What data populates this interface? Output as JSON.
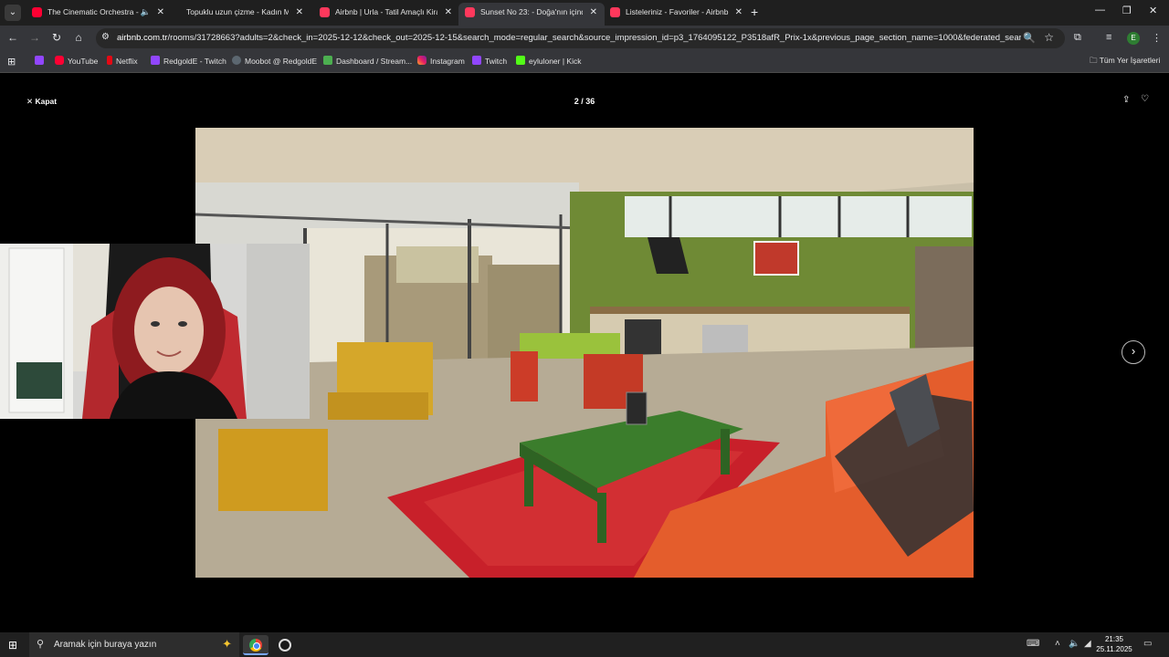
{
  "browser": {
    "tabs": [
      {
        "title": "The Cinematic Orchestra - T",
        "favicon": "youtube",
        "muted_icon": true,
        "active": false
      },
      {
        "title": "Topuklu uzun çizme - Kadın Mo",
        "favicon": "none",
        "active": false
      },
      {
        "title": "Airbnb | Urla - Tatil Amaçlı Kira",
        "favicon": "airbnb",
        "active": false
      },
      {
        "title": "Sunset No 23: - Doğa'nın içind",
        "favicon": "airbnb",
        "active": true
      },
      {
        "title": "Listeleriniz - Favoriler - Airbnb",
        "favicon": "airbnb",
        "active": false
      }
    ],
    "url_domain": "airbnb.com.tr",
    "url_rest": "/rooms/31728663?adults=2&check_in=2025-12-12&check_out=2025-12-15&search_mode=regular_search&source_impression_id=p3_1764095122_P3518afR_Prix-1x&previous_page_section_name=1000&federated_search_i...",
    "profile_initial": "E",
    "bookmarks": [
      {
        "label": "",
        "icon": "twitch"
      },
      {
        "label": "YouTube",
        "icon": "yt"
      },
      {
        "label": "Netflix",
        "icon": "nf"
      },
      {
        "label": "RedgoldE - Twitch",
        "icon": "twitch"
      },
      {
        "label": "Moobot @ RedgoldE",
        "icon": "moo"
      },
      {
        "label": "Dashboard / Stream...",
        "icon": "dash"
      },
      {
        "label": "Instagram",
        "icon": "ig"
      },
      {
        "label": "Twitch",
        "icon": "twitch"
      },
      {
        "label": "eyluloner | Kick",
        "icon": "kick"
      }
    ],
    "all_bookmarks_label": "Tüm Yer İşaretleri"
  },
  "viewer": {
    "close_label": "Kapat",
    "counter": "2 / 36",
    "next_icon": "chevron-right-icon"
  },
  "taskbar": {
    "search_placeholder": "Aramak için buraya yazın",
    "time": "21:35",
    "date": "25.11.2025"
  },
  "colors": {
    "airbnb_accent": "#ff385c",
    "tab_bar": "#1f1f1f",
    "toolbar": "#35363a"
  }
}
